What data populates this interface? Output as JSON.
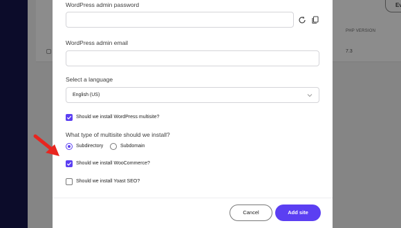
{
  "background": {
    "pill_label": "Ev",
    "col_header": "PHP VERSION",
    "col_value": "7.3"
  },
  "modal": {
    "password_label": "WordPress admin password",
    "password_value": "",
    "email_label": "WordPress admin email",
    "email_value": "",
    "language_label": "Select a language",
    "language_value": "English (US)",
    "multisite_checkbox": {
      "label": "Should we install WordPress multisite?",
      "checked": true
    },
    "multisite_type_label": "What type of multisite should we install?",
    "multisite_type_options": [
      {
        "label": "Subdirectory",
        "selected": true
      },
      {
        "label": "Subdomain",
        "selected": false
      }
    ],
    "woocommerce_checkbox": {
      "label": "Should we install WooCommerce?",
      "checked": true
    },
    "yoast_checkbox": {
      "label": "Should we install Yoast SEO?",
      "checked": false
    },
    "cancel_label": "Cancel",
    "submit_label": "Add site"
  },
  "colors": {
    "accent": "#5b3ff2",
    "arrow": "#e8251f",
    "sidebar": "#0c0c2a"
  },
  "icons": [
    "refresh-icon",
    "copy-icon",
    "chevron-down-icon",
    "checkmark-icon",
    "red-arrow-annotation"
  ]
}
